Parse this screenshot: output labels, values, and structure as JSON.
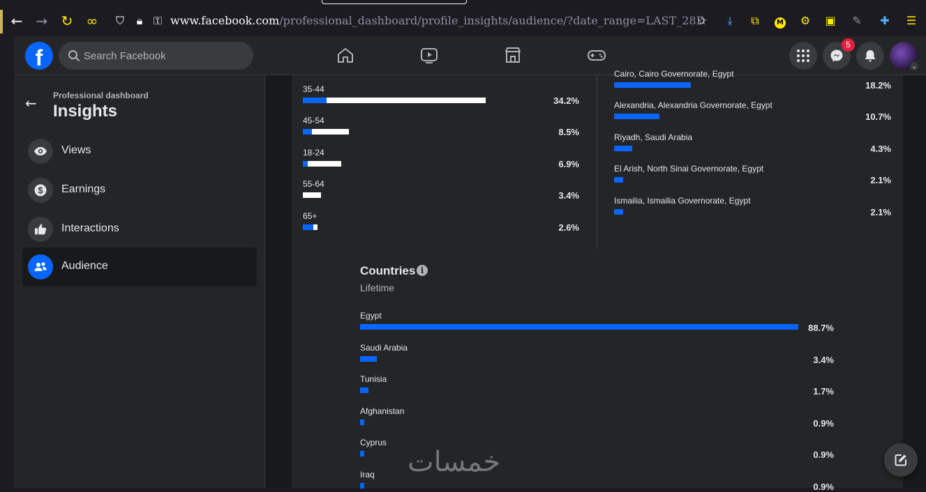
{
  "browser": {
    "url_host": "www.facebook.com",
    "url_path": "/professional_dashboard/profile_insights/audience/?date_range=LAST_28D"
  },
  "header": {
    "search_placeholder": "Search Facebook",
    "messenger_badge": "5"
  },
  "sidebar": {
    "subtitle": "Professional dashboard",
    "title": "Insights",
    "items": [
      {
        "label": "Views"
      },
      {
        "label": "Earnings"
      },
      {
        "label": "Interactions"
      },
      {
        "label": "Audience"
      }
    ]
  },
  "age_groups": [
    {
      "label": "35-44",
      "pct": "34.2%",
      "blue_frac": 0.13,
      "total_frac": 1.0
    },
    {
      "label": "45-54",
      "pct": "8.5%",
      "blue_frac": 0.2,
      "total_frac": 0.25
    },
    {
      "label": "18-24",
      "pct": "6.9%",
      "blue_frac": 0.13,
      "total_frac": 0.21
    },
    {
      "label": "55-64",
      "pct": "3.4%",
      "blue_frac": 0.0,
      "total_frac": 0.1
    },
    {
      "label": "65+",
      "pct": "2.6%",
      "blue_frac": 0.7,
      "total_frac": 0.08
    }
  ],
  "cities": [
    {
      "label": "Cairo, Cairo Governorate, Egypt",
      "pct": "18.2%",
      "value": 18.2
    },
    {
      "label": "Alexandria, Alexandria Governorate, Egypt",
      "pct": "10.7%",
      "value": 10.7
    },
    {
      "label": "Riyadh, Saudi Arabia",
      "pct": "4.3%",
      "value": 4.3
    },
    {
      "label": "El Arish, North Sinai Governorate, Egypt",
      "pct": "2.1%",
      "value": 2.1
    },
    {
      "label": "Ismailia, Ismailia Governorate, Egypt",
      "pct": "2.1%",
      "value": 2.1
    }
  ],
  "countries": {
    "title": "Countries",
    "subtitle": "Lifetime",
    "items": [
      {
        "label": "Egypt",
        "pct": "88.7%",
        "value": 88.7
      },
      {
        "label": "Saudi Arabia",
        "pct": "3.4%",
        "value": 3.4
      },
      {
        "label": "Tunisia",
        "pct": "1.7%",
        "value": 1.7
      },
      {
        "label": "Afghanistan",
        "pct": "0.9%",
        "value": 0.9
      },
      {
        "label": "Cyprus",
        "pct": "0.9%",
        "value": 0.9
      },
      {
        "label": "Iraq",
        "pct": "0.9%",
        "value": 0.9
      }
    ]
  },
  "watermark": "خمسات",
  "colors": {
    "accent": "#0866ff",
    "card": "#242526",
    "bg": "#18191a",
    "text": "#e4e6eb"
  }
}
